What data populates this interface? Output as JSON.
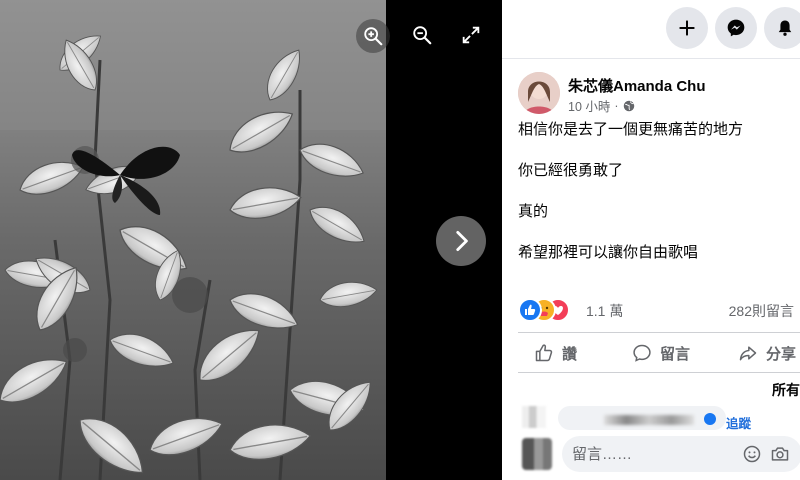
{
  "viewer": {
    "controls": [
      "zoom-in",
      "zoom-out",
      "fullscreen",
      "next"
    ]
  },
  "topbar": {
    "buttons": [
      "create",
      "messenger",
      "notifications"
    ]
  },
  "post": {
    "author": "朱芯儀Amanda Chu",
    "time": "10 小時",
    "separator": "·",
    "privacy_icon": "globe-icon",
    "lines": [
      "相信你是去了一個更無痛苦的地方",
      "你已經很勇敢了",
      "真的",
      "希望那裡可以讓你自由歌唱"
    ],
    "reactions": {
      "types": [
        "like",
        "care",
        "love"
      ],
      "count": "1.1 萬"
    },
    "comment_count": "282則留言"
  },
  "actions": {
    "like": "讚",
    "comment": "留言",
    "share": "分享"
  },
  "comments": {
    "sort_label": "所有",
    "follow_label": "追蹤",
    "input_placeholder": "留言……"
  },
  "colors": {
    "panel_bg": "#ffffff",
    "button_bg": "#e4e6eb",
    "secondary_text": "#65676b",
    "link": "#216fdb",
    "like_blue": "#1877f2",
    "love_red": "#f33e58",
    "care_yellow": "#f7b125"
  }
}
